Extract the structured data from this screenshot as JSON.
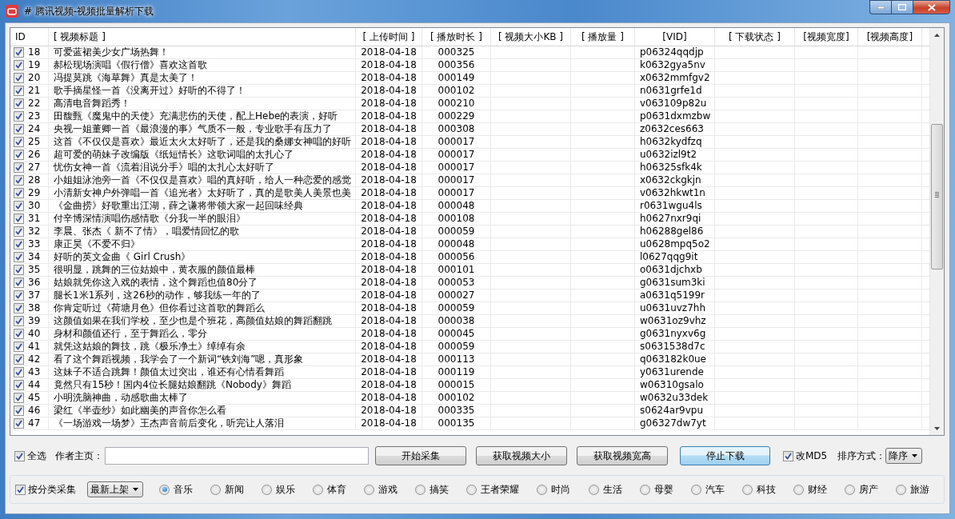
{
  "window": {
    "title": "# 腾讯视频-视频批量解析下载"
  },
  "table": {
    "columns": [
      "ID",
      "[ 视频标题 ]",
      "[ 上传时间 ]",
      "[ 播放时长 ]",
      "[ 视频大小KB ]",
      "[ 播放量 ]",
      "[VID]",
      "[ 下载状态 ]",
      "[视频宽度]",
      "[视频高度]"
    ],
    "rows": [
      {
        "checked": true,
        "id": "18",
        "title": "可爱蓝裙美少女广场热舞！",
        "upload_time": "2018-04-18",
        "duration": "000325",
        "vid": "p06324qqdjp"
      },
      {
        "checked": true,
        "id": "19",
        "title": "郝松现场演唱《假行僧》喜欢这首歌",
        "upload_time": "2018-04-18",
        "duration": "000356",
        "vid": "k0632gya5nv"
      },
      {
        "checked": true,
        "id": "20",
        "title": "冯提莫跳《海草舞》真是太美了！",
        "upload_time": "2018-04-18",
        "duration": "000149",
        "vid": "x0632mmfgv2"
      },
      {
        "checked": true,
        "id": "21",
        "title": "歌手摘星怪一首《没离开过》好听的不得了！",
        "upload_time": "2018-04-18",
        "duration": "000102",
        "vid": "n0631grfe1d"
      },
      {
        "checked": true,
        "id": "22",
        "title": "高清电音舞蹈秀！",
        "upload_time": "2018-04-18",
        "duration": "000210",
        "vid": "v063109p82u"
      },
      {
        "checked": true,
        "id": "23",
        "title": "田馥甄《魔鬼中的天使》充满悲伤的天使，配上Hebe的表演，好听",
        "upload_time": "2018-04-18",
        "duration": "000229",
        "vid": "p0631dxmzbw"
      },
      {
        "checked": true,
        "id": "24",
        "title": "央视一姐董卿一首《最浪漫的事》气质不一般，专业歌手有压力了",
        "upload_time": "2018-04-18",
        "duration": "000308",
        "vid": "z0632ces663"
      },
      {
        "checked": true,
        "id": "25",
        "title": "这首《不仅仅是喜欢》最近太火太好听了，还是我的桑娜女神唱的好听",
        "upload_time": "2018-04-18",
        "duration": "000017",
        "vid": "h0632kydfzq"
      },
      {
        "checked": true,
        "id": "26",
        "title": "超可爱的萌妹子改编版《纸短情长》这歌词唱的太扎心了",
        "upload_time": "2018-04-18",
        "duration": "000017",
        "vid": "u0632izl9t2"
      },
      {
        "checked": true,
        "id": "27",
        "title": "忧伤女神一首《流着泪说分手》唱的太扎心太好听了",
        "upload_time": "2018-04-18",
        "duration": "000017",
        "vid": "h06325sfk4k"
      },
      {
        "checked": true,
        "id": "28",
        "title": "小姐姐泳池旁一首《不仅仅是喜欢》唱的真好听，给人一种恋爱的感觉",
        "upload_time": "2018-04-18",
        "duration": "000017",
        "vid": "x0632ckgkjn"
      },
      {
        "checked": true,
        "id": "29",
        "title": "小清新女神户外弹唱一首《追光者》太好听了，真的是歌美人美景也美",
        "upload_time": "2018-04-18",
        "duration": "000017",
        "vid": "v0632hkwt1n"
      },
      {
        "checked": true,
        "id": "30",
        "title": "《金曲捞》好歌重出江湖，薛之谦将带领大家一起回味经典",
        "upload_time": "2018-04-18",
        "duration": "000048",
        "vid": "r0631wgu4ls"
      },
      {
        "checked": true,
        "id": "31",
        "title": "付辛博深情演唱伤感情歌《分我一半的眼泪》",
        "upload_time": "2018-04-18",
        "duration": "000108",
        "vid": "h0627nxr9qi"
      },
      {
        "checked": true,
        "id": "32",
        "title": "李晨、张杰《 新不了情》，唱爱情回忆的歌",
        "upload_time": "2018-04-18",
        "duration": "000059",
        "vid": "h06288gel86"
      },
      {
        "checked": true,
        "id": "33",
        "title": "康正昊《不爱不归》",
        "upload_time": "2018-04-18",
        "duration": "000048",
        "vid": "u0628mpq5o2"
      },
      {
        "checked": true,
        "id": "34",
        "title": "好听的英文金曲《 Girl Crush》",
        "upload_time": "2018-04-18",
        "duration": "000056",
        "vid": "l0627qqg9it"
      },
      {
        "checked": true,
        "id": "35",
        "title": "很明显，跳舞的三位姑娘中，黄衣服的颜值最棒",
        "upload_time": "2018-04-18",
        "duration": "000101",
        "vid": "o0631djchxb"
      },
      {
        "checked": true,
        "id": "36",
        "title": "姑娘就凭你这入戏的表情，这个舞蹈也值80分了",
        "upload_time": "2018-04-18",
        "duration": "000053",
        "vid": "g0631sum3ki"
      },
      {
        "checked": true,
        "id": "37",
        "title": "腿长1米1系列，这26秒的动作，够我练一年的了",
        "upload_time": "2018-04-18",
        "duration": "000027",
        "vid": "a0631q5199r"
      },
      {
        "checked": true,
        "id": "38",
        "title": "你肯定听过《荷塘月色》但你看过这首歌的舞蹈么",
        "upload_time": "2018-04-18",
        "duration": "000059",
        "vid": "u0631uvz7hh"
      },
      {
        "checked": true,
        "id": "39",
        "title": "这颜值如果在我们学校，至少也是个班花，高颜值姑娘的舞蹈翻跳",
        "upload_time": "2018-04-18",
        "duration": "000038",
        "vid": "w0631oz9vhz"
      },
      {
        "checked": true,
        "id": "40",
        "title": "身材和颜值还行，至于舞蹈么，零分",
        "upload_time": "2018-04-18",
        "duration": "000045",
        "vid": "g0631nyxv6g"
      },
      {
        "checked": true,
        "id": "41",
        "title": "就凭这姑娘的舞技，跳《极乐净土》绰绰有余",
        "upload_time": "2018-04-18",
        "duration": "000059",
        "vid": "s0631538d7c"
      },
      {
        "checked": true,
        "id": "42",
        "title": "看了这个舞蹈视频，我学会了一个新词“铁刘海”嗯，真形象",
        "upload_time": "2018-04-18",
        "duration": "000113",
        "vid": "q063182k0ue"
      },
      {
        "checked": true,
        "id": "43",
        "title": "这妹子不适合跳舞！颜值太过突出，谁还有心情看舞蹈",
        "upload_time": "2018-04-18",
        "duration": "000119",
        "vid": "y0631urende"
      },
      {
        "checked": true,
        "id": "44",
        "title": "竟然只有15秒！国内4位长腿姑娘翻跳《Nobody》舞蹈",
        "upload_time": "2018-04-18",
        "duration": "000015",
        "vid": "w06310gsalo"
      },
      {
        "checked": true,
        "id": "45",
        "title": "小明洗脑神曲，动感歌曲太棒了",
        "upload_time": "2018-04-18",
        "duration": "000102",
        "vid": "w0632u33dek"
      },
      {
        "checked": true,
        "id": "46",
        "title": "梁红《半壶纱》如此幽美的声音你怎么看",
        "upload_time": "2018-04-18",
        "duration": "000335",
        "vid": "s0624ar9vpu"
      },
      {
        "checked": true,
        "id": "47",
        "title": "《一场游戏一场梦》王杰声音前后变化，听完让人落泪",
        "upload_time": "2018-04-18",
        "duration": "000135",
        "vid": "g06327dw7yt"
      }
    ]
  },
  "controls": {
    "select_all": {
      "label": "全选",
      "checked": true
    },
    "author_label": "作者主页：",
    "buttons": [
      {
        "label": "开始采集",
        "default": false
      },
      {
        "label": "获取视频大小",
        "default": false
      },
      {
        "label": "获取视频宽高",
        "default": false
      },
      {
        "label": "停止下载",
        "default": true
      }
    ],
    "md5": {
      "label": "改MD5",
      "checked": true
    },
    "sort_label": "排序方式：",
    "sort_value": "降序"
  },
  "category": {
    "checkbox": {
      "label": "按分类采集",
      "checked": true
    },
    "dropdown": "最新上架",
    "options": [
      {
        "label": "音乐",
        "selected": true
      },
      {
        "label": "新闻",
        "selected": false
      },
      {
        "label": "娱乐",
        "selected": false
      },
      {
        "label": "体育",
        "selected": false
      },
      {
        "label": "游戏",
        "selected": false
      },
      {
        "label": "搞笑",
        "selected": false
      },
      {
        "label": "王者荣耀",
        "selected": false
      },
      {
        "label": "时尚",
        "selected": false
      },
      {
        "label": "生活",
        "selected": false
      },
      {
        "label": "母婴",
        "selected": false
      },
      {
        "label": "汽车",
        "selected": false
      },
      {
        "label": "科技",
        "selected": false
      },
      {
        "label": "财经",
        "selected": false
      },
      {
        "label": "房产",
        "selected": false
      },
      {
        "label": "旅游",
        "selected": false
      }
    ]
  }
}
